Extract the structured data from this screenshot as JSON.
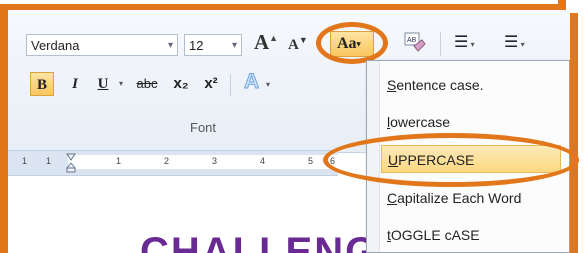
{
  "font_group": {
    "font_name": "Verdana",
    "font_size": "12",
    "grow_label": "A",
    "shrink_label": "A",
    "change_case_label": "Aa",
    "bold_label": "B",
    "italic_label": "I",
    "underline_label": "U",
    "strike_label": "abc",
    "subscript_label": "x₂",
    "superscript_label": "x²",
    "text_effects_label": "A",
    "group_label": "Font"
  },
  "paragraph_group": {
    "bullets_label": "☰",
    "numbering_label": "☰"
  },
  "ruler": {
    "labels": [
      "1",
      "1",
      "1",
      "2",
      "3",
      "4",
      "5",
      "6"
    ]
  },
  "document": {
    "heading_fragment": "CHALLENG"
  },
  "change_case_menu": {
    "items": [
      {
        "first": "S",
        "rest": "entence case."
      },
      {
        "first": "l",
        "rest": "owercase"
      },
      {
        "first": "U",
        "rest": "PPERCASE"
      },
      {
        "first": "C",
        "rest": "apitalize Each Word"
      },
      {
        "first": "t",
        "rest": "OGGLE cASE"
      }
    ],
    "highlighted_index": 2
  },
  "colors": {
    "callout": "#e2761a",
    "highlight": "#fbd780",
    "heading": "#6a2a93"
  }
}
